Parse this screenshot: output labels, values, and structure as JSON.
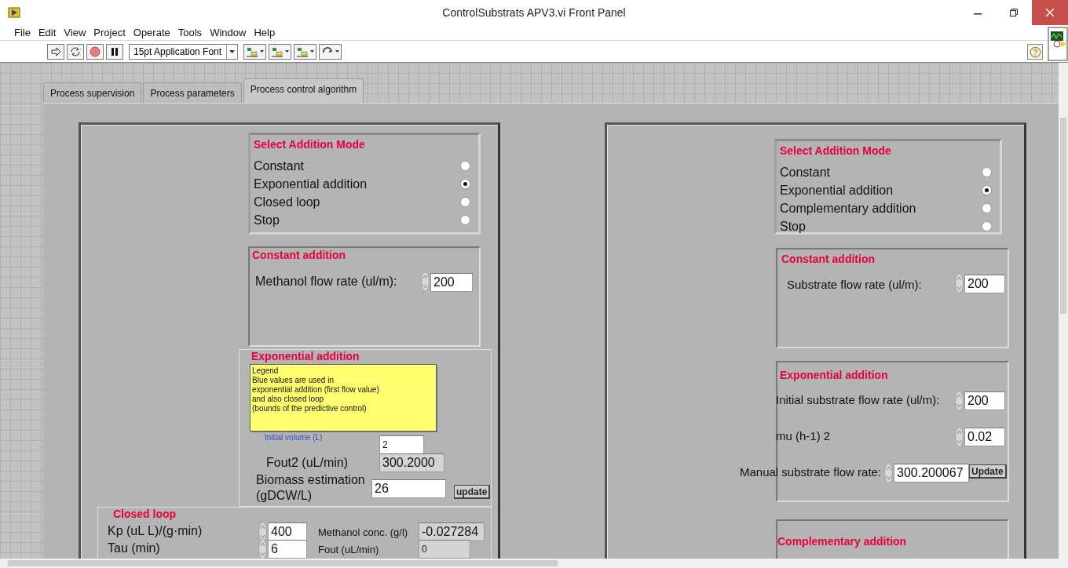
{
  "window": {
    "title": "ControlSubstrats APV3.vi Front Panel"
  },
  "menu": [
    "File",
    "Edit",
    "View",
    "Project",
    "Operate",
    "Tools",
    "Window",
    "Help"
  ],
  "toolbar": {
    "font_selector": "15pt Application Font"
  },
  "tabs": [
    {
      "label": "Process supervision",
      "selected": false
    },
    {
      "label": "Process parameters",
      "selected": false
    },
    {
      "label": "Process control algorithm",
      "selected": true
    }
  ],
  "left_panel": {
    "mode_selector": {
      "title": "Select Addition Mode",
      "options": [
        {
          "label": "Constant",
          "selected": false
        },
        {
          "label": "Exponential addition",
          "selected": true
        },
        {
          "label": "Closed loop",
          "selected": false
        },
        {
          "label": "Stop",
          "selected": false
        }
      ]
    },
    "constant_addition": {
      "title": "Constant addition",
      "label": "Methanol flow rate (ul/m):",
      "value": "200"
    },
    "exponential_addition": {
      "title": "Exponential addition",
      "legend": [
        "Legend",
        "Blue values are used in",
        "exponential addition (first flow value)",
        "and also closed loop",
        "(bounds of the predictive control)"
      ],
      "initial_volume": {
        "label": "Initial volume (L)",
        "value": "2"
      },
      "fout2": {
        "label": "Fout2 (uL/min)",
        "value": "300.2000"
      },
      "biomass": {
        "label": "Biomass estimation (gDCW/L)",
        "value": "26"
      },
      "button": "update"
    },
    "closed_loop": {
      "title": "Closed loop",
      "rows": [
        {
          "label": "Kp (uL L)/(g·min)",
          "value": "400",
          "output_label": "Methanol conc. (g/l)",
          "output": "-0.027284"
        },
        {
          "label": "Tau (min)",
          "value": "6",
          "output_label": "Fout (uL/min)",
          "output": "0"
        }
      ]
    }
  },
  "right_panel": {
    "mode_selector": {
      "title": "Select Addition Mode",
      "options": [
        {
          "label": "Constant",
          "selected": false
        },
        {
          "label": "Exponential addition",
          "selected": true
        },
        {
          "label": "Complementary addition",
          "selected": false
        },
        {
          "label": "Stop",
          "selected": false
        }
      ]
    },
    "constant_addition": {
      "title": "Constant addition",
      "label": "Substrate flow rate (ul/m):",
      "value": "200"
    },
    "exponential_addition": {
      "title": "Exponential addition",
      "fields": [
        {
          "label": "Initial substrate flow rate (ul/m):",
          "value": "200"
        },
        {
          "label": "mu (h-1) 2",
          "value": "0.02"
        },
        {
          "label": "Manual substrate flow rate:",
          "value": "300.200067"
        }
      ],
      "button": "Update"
    },
    "complementary_addition": {
      "title": "Complementary addition"
    }
  }
}
